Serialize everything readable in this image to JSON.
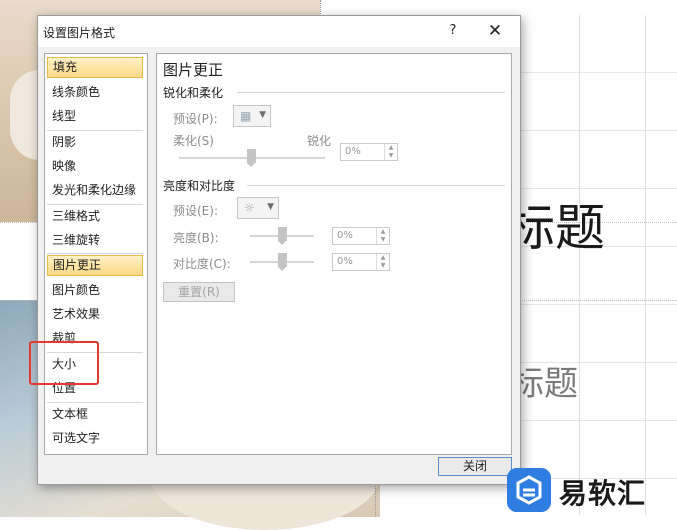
{
  "dialog": {
    "title": "设置图片格式",
    "help_label": "?",
    "close_glyph": "✕",
    "close_button": "关闭"
  },
  "nav": {
    "items": [
      "填充",
      "线条颜色",
      "线型",
      "阴影",
      "映像",
      "发光和柔化边缘",
      "三维格式",
      "三维旋转",
      "图片更正",
      "图片颜色",
      "艺术效果",
      "裁剪",
      "大小",
      "位置",
      "文本框",
      "可选文字"
    ],
    "selected": "图片更正"
  },
  "panel": {
    "title": "图片更正",
    "sharpen_section": {
      "heading": "锐化和柔化",
      "preset_label": "预设(P):",
      "soften_label": "柔化(S)",
      "sharpen_label": "锐化",
      "value": "0%"
    },
    "brightness_section": {
      "heading": "亮度和对比度",
      "preset_label": "预设(E):",
      "brightness_label": "亮度(B):",
      "brightness_value": "0%",
      "contrast_label": "对比度(C):",
      "contrast_value": "0%"
    },
    "reset_button": "重置(R)"
  },
  "slide": {
    "title": "标题",
    "subtitle": "标题"
  },
  "watermark": {
    "text": "易软汇"
  },
  "colors": {
    "accent": "#2f7de1",
    "selection": "#fbd985",
    "highlight": "#e33a30"
  }
}
